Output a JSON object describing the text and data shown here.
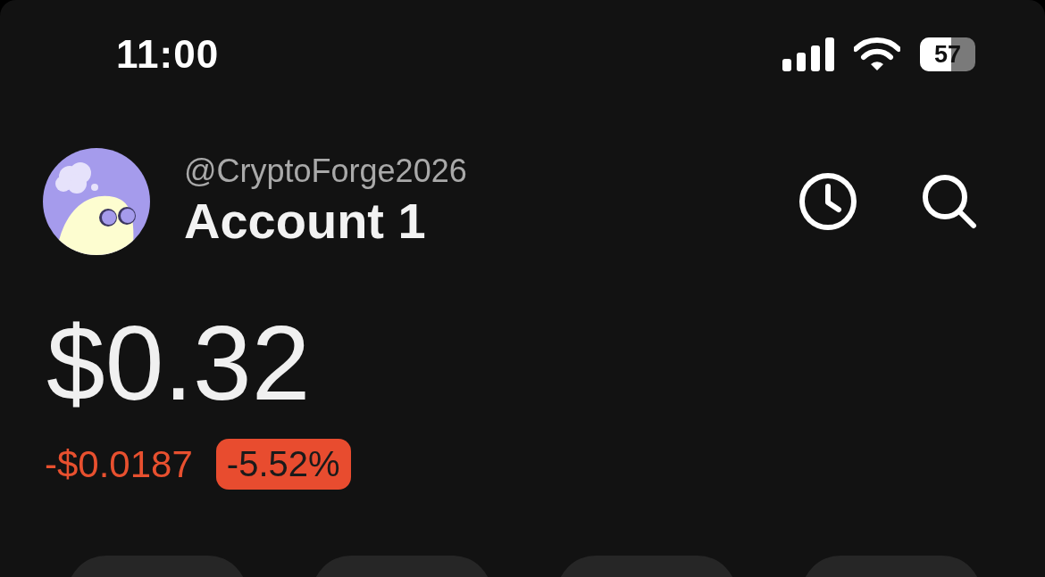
{
  "status_bar": {
    "time": "11:00",
    "battery": "57"
  },
  "account": {
    "handle": "@CryptoForge2026",
    "name": "Account 1"
  },
  "balance": {
    "value": "$0.32",
    "change": "-$0.0187",
    "percent": "-5.52%",
    "negative": true
  },
  "actions": [
    {
      "kind": "button"
    },
    {
      "kind": "button"
    },
    {
      "kind": "button"
    },
    {
      "kind": "button"
    }
  ]
}
